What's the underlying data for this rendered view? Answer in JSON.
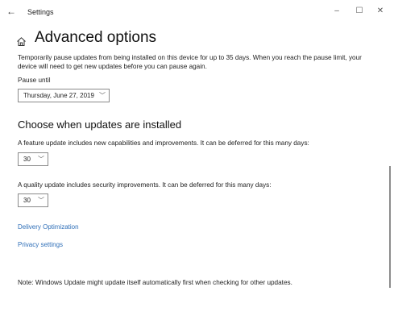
{
  "window": {
    "title": "Settings",
    "back_icon": "←",
    "minimize_icon": "–",
    "maximize_icon": "☐",
    "close_icon": "✕"
  },
  "page": {
    "title": "Advanced options",
    "pause_description": "Temporarily pause updates from being installed on this device for up to 35 days. When you reach the pause limit, your device will need to get new updates before you can pause again.",
    "pause_label": "Pause until",
    "pause_value": "Thursday, June 27, 2019"
  },
  "updates": {
    "section_title": "Choose when updates are installed",
    "feature_label": "A feature update includes new capabilities and improvements. It can be deferred for this many days:",
    "feature_value": "30",
    "quality_label": "A quality update includes security improvements. It can be deferred for this many days:",
    "quality_value": "30"
  },
  "links": {
    "delivery": "Delivery Optimization",
    "privacy": "Privacy settings"
  },
  "note": "Note: Windows Update might update itself automatically first when checking for other updates.",
  "colors": {
    "link": "#2f6fb8"
  }
}
